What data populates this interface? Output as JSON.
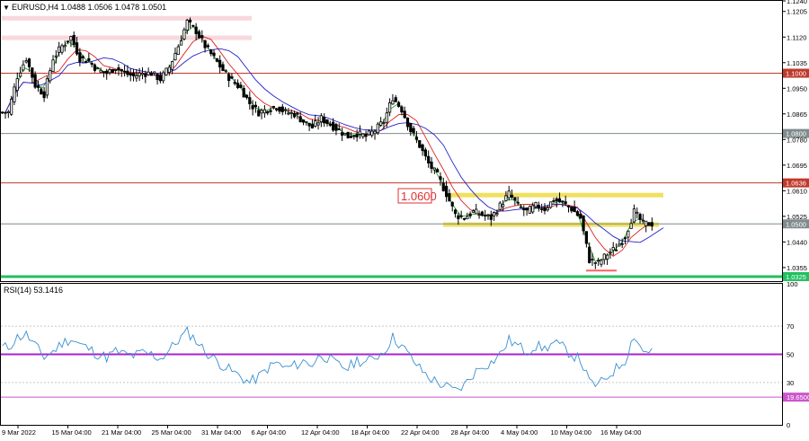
{
  "header": {
    "symbol_line": "EURUSD,H4  1.0488 1.0506 1.0478 1.0501",
    "rsi_label": "RSI(14) 53.1416"
  },
  "colors": {
    "bull": "#000000",
    "bear": "#000000",
    "ma_fast": "#22aa22",
    "ma_mid": "#dd2222",
    "ma_slow": "#2222cc",
    "resistance": "#c0392b",
    "support": "#7f8c8d",
    "zone": "#f0e060",
    "pink_band": "#f8d8dc",
    "green_base": "#20c060",
    "rsi_line": "#3a8fd0",
    "rsi_mid": "#aa22cc",
    "rsi_low": "#cc55cc",
    "annotation": "#e03030"
  },
  "chart_data": [
    {
      "type": "candlestick",
      "symbol": "EURUSD",
      "timeframe": "H4",
      "last_ohlc": {
        "open": 1.0488,
        "high": 1.0506,
        "low": 1.0478,
        "close": 1.0501
      },
      "ylim": [
        1.031,
        1.124
      ],
      "y_tick_labels": [
        "1.1240",
        "1.1205",
        "1.1120",
        "1.1035",
        "1.1000",
        "1.0950",
        "1.0865",
        "1.0800",
        "1.0780",
        "1.0695",
        "1.0636",
        "1.0610",
        "1.0525",
        "1.0500",
        "1.0440",
        "1.0355",
        "1.0325"
      ],
      "x_tick_labels": [
        "9 Mar 2022",
        "15 Mar 04:00",
        "21 Mar 04:00",
        "25 Mar 04:00",
        "31 Mar 04:00",
        "6 Apr 04:00",
        "12 Apr 04:00",
        "18 Apr 04:00",
        "22 Apr 04:00",
        "28 Apr 04:00",
        "4 May 04:00",
        "10 May 04:00",
        "16 May 04:00"
      ],
      "series": [
        {
          "name": "price",
          "close": [
            1.087,
            1.099,
            1.105,
            1.096,
            1.093,
            1.105,
            1.109,
            1.112,
            1.105,
            1.104,
            1.101,
            1.1,
            1.102,
            1.1,
            1.099,
            1.1,
            1.1,
            1.098,
            1.102,
            1.109,
            1.117,
            1.114,
            1.109,
            1.105,
            1.101,
            1.0975,
            1.095,
            1.09,
            1.087,
            1.088,
            1.089,
            1.087,
            1.0865,
            1.084,
            1.082,
            1.085,
            1.083,
            1.081,
            1.079,
            1.08,
            1.079,
            1.081,
            1.084,
            1.092,
            1.088,
            1.081,
            1.076,
            1.07,
            1.066,
            1.06,
            1.053,
            1.052,
            1.054,
            1.053,
            1.052,
            1.056,
            1.06,
            1.056,
            1.054,
            1.056,
            1.055,
            1.058,
            1.057,
            1.055,
            1.052,
            1.038,
            1.037,
            1.04,
            1.042,
            1.046,
            1.054,
            1.05,
            1.0501
          ]
        }
      ],
      "horizontal_levels": [
        {
          "value": 1.1,
          "label": "1.1000",
          "role": "resistance"
        },
        {
          "value": 1.08,
          "label": "1.0800",
          "role": "support"
        },
        {
          "value": 1.0636,
          "label": "1.0636",
          "role": "resistance"
        },
        {
          "value": 1.05,
          "label": "1.0500",
          "role": "support"
        },
        {
          "value": 1.0325,
          "label": "1.0325",
          "role": "base"
        }
      ],
      "annotation": "1.0600"
    },
    {
      "type": "line",
      "name": "RSI(14)",
      "current": 53.1416,
      "ylim": [
        0,
        100
      ],
      "y_tick_labels": [
        "100",
        "70",
        "50",
        "30",
        "19.6500",
        "0"
      ],
      "levels": [
        70,
        50,
        30,
        19.65
      ],
      "values": [
        55,
        62,
        64,
        56,
        48,
        52,
        58,
        61,
        57,
        54,
        50,
        48,
        52,
        50,
        49,
        51,
        50,
        47,
        53,
        60,
        66,
        60,
        52,
        47,
        42,
        38,
        34,
        30,
        34,
        40,
        44,
        40,
        42,
        45,
        43,
        50,
        46,
        42,
        40,
        46,
        44,
        48,
        52,
        62,
        56,
        48,
        40,
        34,
        30,
        27,
        24,
        28,
        36,
        42,
        44,
        50,
        60,
        56,
        52,
        56,
        54,
        58,
        55,
        50,
        46,
        30,
        28,
        34,
        40,
        46,
        64,
        52,
        53.14
      ]
    }
  ]
}
